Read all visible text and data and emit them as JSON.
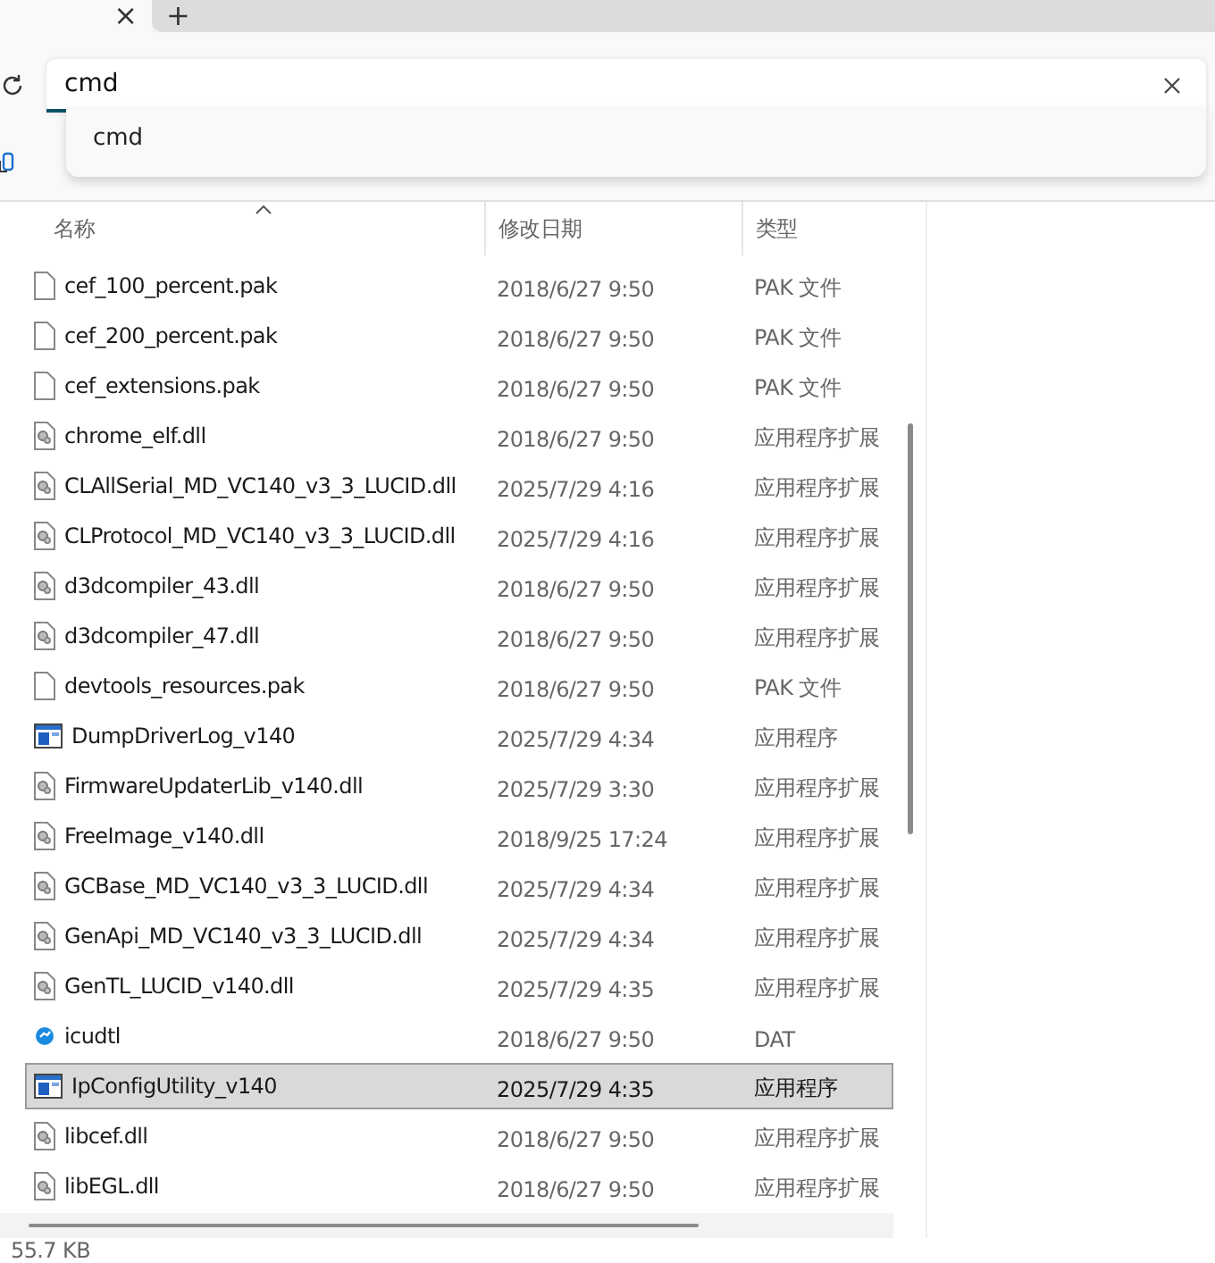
{
  "tab": {
    "close": "×",
    "new_tab": "+"
  },
  "search": {
    "value": "cmd",
    "suggestions": [
      "cmd"
    ]
  },
  "table": {
    "columns": [
      "名称",
      "修改日期",
      "类型"
    ],
    "rows": [
      {
        "name": "cef_100_percent.pak",
        "date": "2018/6/27 9:50",
        "type": "PAK 文件",
        "kind": "file",
        "selected": false
      },
      {
        "name": "cef_200_percent.pak",
        "date": "2018/6/27 9:50",
        "type": "PAK 文件",
        "kind": "file",
        "selected": false
      },
      {
        "name": "cef_extensions.pak",
        "date": "2018/6/27 9:50",
        "type": "PAK 文件",
        "kind": "file",
        "selected": false
      },
      {
        "name": "chrome_elf.dll",
        "date": "2018/6/27 9:50",
        "type": "应用程序扩展",
        "kind": "dll",
        "selected": false
      },
      {
        "name": "CLAllSerial_MD_VC140_v3_3_LUCID.dll",
        "date": "2025/7/29 4:16",
        "type": "应用程序扩展",
        "kind": "dll",
        "selected": false
      },
      {
        "name": "CLProtocol_MD_VC140_v3_3_LUCID.dll",
        "date": "2025/7/29 4:16",
        "type": "应用程序扩展",
        "kind": "dll",
        "selected": false
      },
      {
        "name": "d3dcompiler_43.dll",
        "date": "2018/6/27 9:50",
        "type": "应用程序扩展",
        "kind": "dll",
        "selected": false
      },
      {
        "name": "d3dcompiler_47.dll",
        "date": "2018/6/27 9:50",
        "type": "应用程序扩展",
        "kind": "dll",
        "selected": false
      },
      {
        "name": "devtools_resources.pak",
        "date": "2018/6/27 9:50",
        "type": "PAK 文件",
        "kind": "file",
        "selected": false
      },
      {
        "name": "DumpDriverLog_v140",
        "date": "2025/7/29 4:34",
        "type": "应用程序",
        "kind": "exe",
        "selected": false
      },
      {
        "name": "FirmwareUpdaterLib_v140.dll",
        "date": "2025/7/29 3:30",
        "type": "应用程序扩展",
        "kind": "dll",
        "selected": false
      },
      {
        "name": "FreeImage_v140.dll",
        "date": "2018/9/25 17:24",
        "type": "应用程序扩展",
        "kind": "dll",
        "selected": false
      },
      {
        "name": "GCBase_MD_VC140_v3_3_LUCID.dll",
        "date": "2025/7/29 4:34",
        "type": "应用程序扩展",
        "kind": "dll",
        "selected": false
      },
      {
        "name": "GenApi_MD_VC140_v3_3_LUCID.dll",
        "date": "2025/7/29 4:34",
        "type": "应用程序扩展",
        "kind": "dll",
        "selected": false
      },
      {
        "name": "GenTL_LUCID_v140.dll",
        "date": "2025/7/29 4:35",
        "type": "应用程序扩展",
        "kind": "dll",
        "selected": false
      },
      {
        "name": "icudtl",
        "date": "2018/6/27 9:50",
        "type": "DAT",
        "kind": "dat",
        "selected": false
      },
      {
        "name": "IpConfigUtility_v140",
        "date": "2025/7/29 4:35",
        "type": "应用程序",
        "kind": "exe",
        "selected": true
      },
      {
        "name": "libcef.dll",
        "date": "2018/6/27 9:50",
        "type": "应用程序扩展",
        "kind": "dll",
        "selected": false
      },
      {
        "name": "libEGL.dll",
        "date": "2018/6/27 9:50",
        "type": "应用程序扩展",
        "kind": "dll",
        "selected": false
      }
    ]
  },
  "status_bar": {
    "size": "55.7 KB"
  }
}
